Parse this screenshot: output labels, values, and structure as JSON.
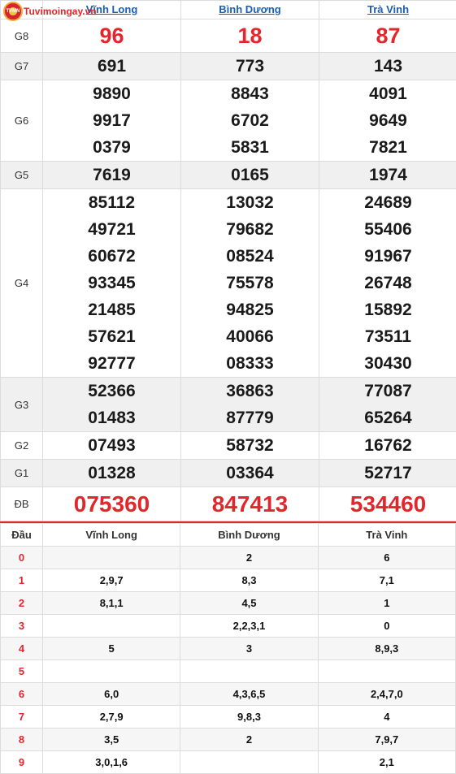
{
  "site": {
    "name": "Tuvimoingay.vn",
    "mark": "TVMN"
  },
  "provinces": [
    "Vĩnh Long",
    "Bình Dương",
    "Trà Vinh"
  ],
  "results": [
    {
      "label": "G8",
      "type": "g8",
      "values": [
        [
          "96"
        ],
        [
          "18"
        ],
        [
          "87"
        ]
      ]
    },
    {
      "label": "G7",
      "type": "normal",
      "values": [
        [
          "691"
        ],
        [
          "773"
        ],
        [
          "143"
        ]
      ]
    },
    {
      "label": "G6",
      "type": "normal",
      "values": [
        [
          "9890",
          "9917",
          "0379"
        ],
        [
          "8843",
          "6702",
          "5831"
        ],
        [
          "4091",
          "9649",
          "7821"
        ]
      ]
    },
    {
      "label": "G5",
      "type": "normal",
      "values": [
        [
          "7619"
        ],
        [
          "0165"
        ],
        [
          "1974"
        ]
      ]
    },
    {
      "label": "G4",
      "type": "normal",
      "values": [
        [
          "85112",
          "49721",
          "60672",
          "93345",
          "21485",
          "57621",
          "92777"
        ],
        [
          "13032",
          "79682",
          "08524",
          "75578",
          "94825",
          "40066",
          "08333"
        ],
        [
          "24689",
          "55406",
          "91967",
          "26748",
          "15892",
          "73511",
          "30430"
        ]
      ]
    },
    {
      "label": "G3",
      "type": "normal",
      "values": [
        [
          "52366",
          "01483"
        ],
        [
          "36863",
          "87779"
        ],
        [
          "77087",
          "65264"
        ]
      ]
    },
    {
      "label": "G2",
      "type": "normal",
      "values": [
        [
          "07493"
        ],
        [
          "58732"
        ],
        [
          "16762"
        ]
      ]
    },
    {
      "label": "G1",
      "type": "normal",
      "values": [
        [
          "01328"
        ],
        [
          "03364"
        ],
        [
          "52717"
        ]
      ]
    },
    {
      "label": "ĐB",
      "type": "db",
      "values": [
        [
          "075360"
        ],
        [
          "847413"
        ],
        [
          "534460"
        ]
      ]
    }
  ],
  "loto": {
    "head_label": "Đầu",
    "columns": [
      "Vĩnh Long",
      "Bình Dương",
      "Trà Vinh"
    ],
    "rows": [
      {
        "digit": "0",
        "values": [
          "",
          "2",
          "6"
        ]
      },
      {
        "digit": "1",
        "values": [
          "2,9,7",
          "8,3",
          "7,1"
        ]
      },
      {
        "digit": "2",
        "values": [
          "8,1,1",
          "4,5",
          "1"
        ]
      },
      {
        "digit": "3",
        "values": [
          "",
          "2,2,3,1",
          "0"
        ]
      },
      {
        "digit": "4",
        "values": [
          "5",
          "3",
          "8,9,3"
        ]
      },
      {
        "digit": "5",
        "values": [
          "",
          "",
          ""
        ]
      },
      {
        "digit": "6",
        "values": [
          "6,0",
          "4,3,6,5",
          "2,4,7,0"
        ]
      },
      {
        "digit": "7",
        "values": [
          "2,7,9",
          "9,8,3",
          "4"
        ]
      },
      {
        "digit": "8",
        "values": [
          "3,5",
          "2",
          "7,9,7"
        ]
      },
      {
        "digit": "9",
        "values": [
          "3,0,1,6",
          "",
          "2,1"
        ]
      }
    ]
  },
  "colors": {
    "red": "#e3262c",
    "link": "#1a5fb4",
    "shade": "#f0f0f0"
  }
}
